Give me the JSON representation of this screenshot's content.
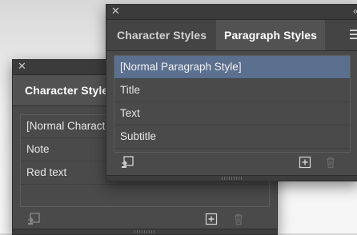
{
  "back_panel": {
    "tabs": [
      {
        "label": "Character Styles"
      }
    ],
    "items": [
      {
        "label": "[Normal Character Style]"
      },
      {
        "label": "Note"
      },
      {
        "label": "Red text"
      }
    ]
  },
  "front_panel": {
    "tabs": [
      {
        "label": "Character Styles"
      },
      {
        "label": "Paragraph Styles"
      }
    ],
    "items": [
      {
        "label": "[Normal Paragraph Style]",
        "selected": true
      },
      {
        "label": "Title"
      },
      {
        "label": "Text"
      },
      {
        "label": "Subtitle"
      }
    ]
  },
  "icons": {
    "close": "close-icon",
    "panel_menu": "panel-menu-icon",
    "load_styles": "load-styles-icon",
    "new_style": "new-style-icon",
    "delete_style": "trash-icon"
  },
  "colors": {
    "panel_bg": "#4a4a4a",
    "selected_row": "#5b6f8e",
    "active_tab": "#525252"
  }
}
